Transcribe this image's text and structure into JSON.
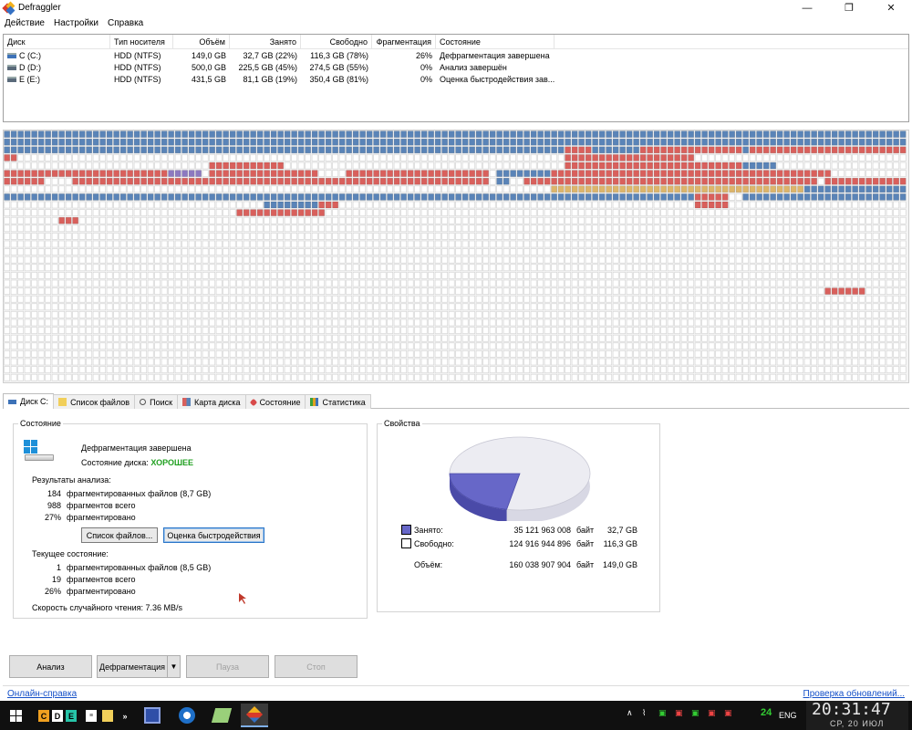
{
  "window": {
    "title": "Defraggler",
    "controls": {
      "minimize": "—",
      "maximize": "❐",
      "close": "✕"
    }
  },
  "menu": [
    "Действие",
    "Настройки",
    "Справка"
  ],
  "drive_list": {
    "columns": [
      "Диск",
      "Тип носителя",
      "Объём",
      "Занято",
      "Свободно",
      "Фрагментация",
      "Состояние"
    ],
    "rows": [
      {
        "disk": "C (C:)",
        "type": "HDD (NTFS)",
        "size": "149,0 GB",
        "used": "32,7 GB (22%)",
        "free": "116,3 GB (78%)",
        "frag": "26%",
        "state": "Дефрагментация завершена"
      },
      {
        "disk": "D (D:)",
        "type": "HDD (NTFS)",
        "size": "500,0 GB",
        "used": "225,5 GB (45%)",
        "free": "274,5 GB (55%)",
        "frag": "0%",
        "state": "Анализ завершён"
      },
      {
        "disk": "E (E:)",
        "type": "HDD (NTFS)",
        "size": "431,5 GB",
        "used": "81,1 GB (19%)",
        "free": "350,4 GB (81%)",
        "frag": "0%",
        "state": "Оценка быстродействия зав..."
      }
    ]
  },
  "disk_map": {
    "colors": {
      "blue": "#5a84b8",
      "red": "#d9605c",
      "purple": "#8c79c0",
      "gold": "#ddb56a",
      "empty": "#ffffff"
    }
  },
  "tabs": [
    {
      "label": "Диск C:",
      "icon": "drive-icon",
      "active": true
    },
    {
      "label": "Список файлов",
      "icon": "folder-icon",
      "active": false
    },
    {
      "label": "Поиск",
      "icon": "search-icon",
      "active": false
    },
    {
      "label": "Карта диска",
      "icon": "map-icon",
      "active": false
    },
    {
      "label": "Состояние",
      "icon": "health-icon",
      "active": false
    },
    {
      "label": "Статистика",
      "icon": "chart-icon",
      "active": false
    }
  ],
  "status": {
    "title": "Состояние",
    "main": "Дефрагментация завершена",
    "health_label": "Состояние диска:",
    "health_value": "ХОРОШЕЕ",
    "analysis_title": "Результаты анализа:",
    "analysis": [
      {
        "num": "184",
        "text": "фрагментированных файлов (8,7 GB)"
      },
      {
        "num": "988",
        "text": "фрагментов всего"
      },
      {
        "num": "27%",
        "text": "фрагментировано"
      }
    ],
    "btn_files": "Список файлов...",
    "btn_bench": "Оценка быстродействия",
    "current_title": "Текущее состояние:",
    "current": [
      {
        "num": "1",
        "text": "фрагментированных файлов (8,5 GB)"
      },
      {
        "num": "19",
        "text": "фрагментов всего"
      },
      {
        "num": "26%",
        "text": "фрагментировано"
      }
    ],
    "read_speed": "Скорость случайного чтения: 7.36 MB/s"
  },
  "properties": {
    "title": "Свойства",
    "used_label": "Занято:",
    "used_bytes": "35 121 963 008",
    "used_unit": "байт",
    "used_gb": "32,7 GB",
    "free_label": "Свободно:",
    "free_bytes": "124 916 944 896",
    "free_unit": "байт",
    "free_gb": "116,3 GB",
    "total_label": "Объём:",
    "total_bytes": "160 038 907 904",
    "total_unit": "байт",
    "total_gb": "149,0 GB",
    "used_fraction": 0.22,
    "used_color": "#6767c8",
    "free_color": "#ececf2"
  },
  "actions": {
    "analyze": "Анализ",
    "defrag": "Дефрагментация",
    "pause": "Пауза",
    "stop": "Стоп"
  },
  "links": {
    "help": "Онлайн-справка",
    "updates": "Проверка обновлений..."
  },
  "taskbar": {
    "quick": [
      "C",
      "D",
      "E"
    ],
    "chevron": "»",
    "lang": "ENG",
    "num": "24",
    "time": "20:31:47",
    "date": "СР, 20 ИЮЛ"
  }
}
